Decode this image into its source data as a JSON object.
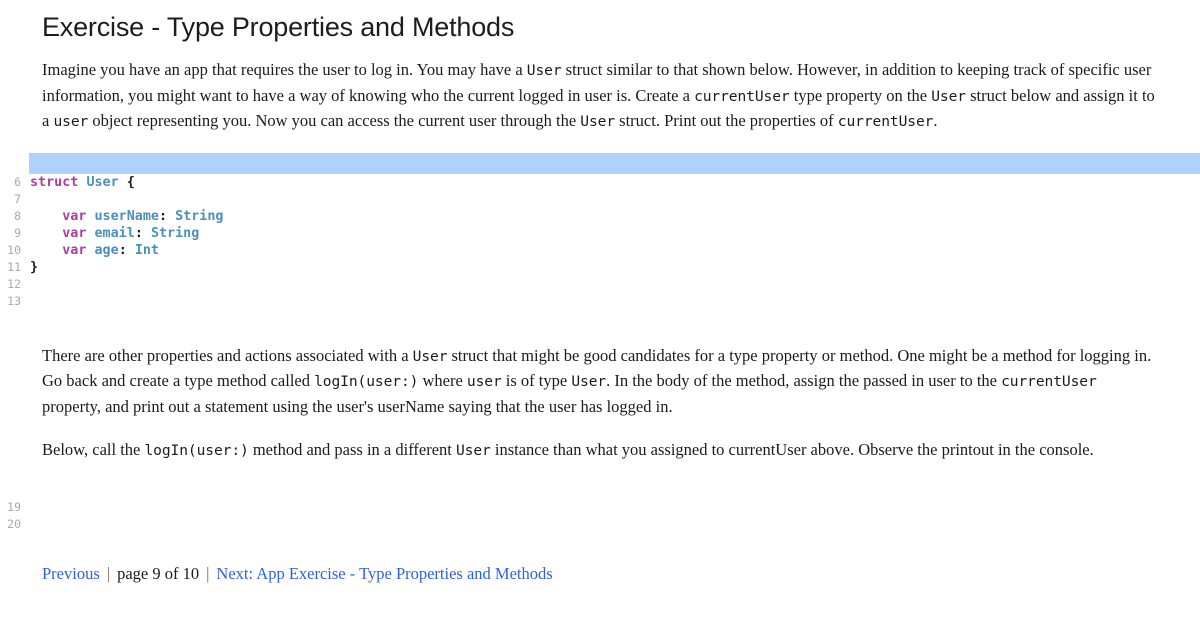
{
  "page": {
    "title": "Exercise - Type Properties and Methods"
  },
  "intro_paragraph": {
    "segments": [
      {
        "type": "text",
        "value": "Imagine you have an app that requires the user to log in. You may have a "
      },
      {
        "type": "code",
        "value": "User"
      },
      {
        "type": "text",
        "value": " struct similar to that shown below. However, in addition to keeping track of specific user information, you might want to have a way of knowing who the current logged in user is. Create a "
      },
      {
        "type": "code",
        "value": "currentUser"
      },
      {
        "type": "text",
        "value": " type property on the "
      },
      {
        "type": "code",
        "value": "User"
      },
      {
        "type": "text",
        "value": " struct below and assign it to a "
      },
      {
        "type": "code",
        "value": "user"
      },
      {
        "type": "text",
        "value": " object representing you. Now you can access the current user through the "
      },
      {
        "type": "code",
        "value": "User"
      },
      {
        "type": "text",
        "value": " struct. Print out the properties of "
      },
      {
        "type": "code",
        "value": "currentUser"
      },
      {
        "type": "text",
        "value": "."
      }
    ]
  },
  "editor": {
    "highlight_color": "#aed2fc",
    "first_visible_line": 6,
    "lines": [
      {
        "number": "6",
        "tokens": [
          {
            "cls": "kw",
            "text": "struct"
          },
          {
            "cls": "pln",
            "text": " "
          },
          {
            "cls": "typ",
            "text": "User"
          },
          {
            "cls": "pln",
            "text": " {"
          }
        ]
      },
      {
        "number": "7",
        "tokens": []
      },
      {
        "number": "8",
        "tokens": [
          {
            "cls": "pln",
            "text": "    "
          },
          {
            "cls": "kw",
            "text": "var"
          },
          {
            "cls": "pln",
            "text": " "
          },
          {
            "cls": "typ",
            "text": "userName"
          },
          {
            "cls": "pln",
            "text": ": "
          },
          {
            "cls": "typ",
            "text": "String"
          }
        ]
      },
      {
        "number": "9",
        "tokens": [
          {
            "cls": "pln",
            "text": "    "
          },
          {
            "cls": "kw",
            "text": "var"
          },
          {
            "cls": "pln",
            "text": " "
          },
          {
            "cls": "typ",
            "text": "email"
          },
          {
            "cls": "pln",
            "text": ": "
          },
          {
            "cls": "typ",
            "text": "String"
          }
        ]
      },
      {
        "number": "10",
        "tokens": [
          {
            "cls": "pln",
            "text": "    "
          },
          {
            "cls": "kw",
            "text": "var"
          },
          {
            "cls": "pln",
            "text": " "
          },
          {
            "cls": "typ",
            "text": "age"
          },
          {
            "cls": "pln",
            "text": ": "
          },
          {
            "cls": "typ",
            "text": "Int"
          }
        ]
      },
      {
        "number": "11",
        "tokens": [
          {
            "cls": "pln",
            "text": "}"
          }
        ]
      },
      {
        "number": "12",
        "tokens": []
      },
      {
        "number": "13",
        "tokens": []
      }
    ],
    "tail_lines": [
      {
        "number": "19",
        "tokens": []
      },
      {
        "number": "20",
        "tokens": []
      }
    ]
  },
  "middle_paragraph": {
    "segments": [
      {
        "type": "text",
        "value": "There are other properties and actions associated with a "
      },
      {
        "type": "code",
        "value": "User"
      },
      {
        "type": "text",
        "value": " struct that might be good candidates for a type property or method. One might be a method for logging in. Go back and create a type method called "
      },
      {
        "type": "code",
        "value": "logIn(user:)"
      },
      {
        "type": "text",
        "value": " where "
      },
      {
        "type": "code",
        "value": "user"
      },
      {
        "type": "text",
        "value": " is of type "
      },
      {
        "type": "code",
        "value": "User"
      },
      {
        "type": "text",
        "value": ". In the body of the method, assign the passed in user to the "
      },
      {
        "type": "code",
        "value": "currentUser"
      },
      {
        "type": "text",
        "value": " property, and print out a statement using the user's userName saying that the user has logged in."
      }
    ]
  },
  "below_paragraph": {
    "segments": [
      {
        "type": "text",
        "value": "Below, call the "
      },
      {
        "type": "code",
        "value": "logIn(user:)"
      },
      {
        "type": "text",
        "value": " method and pass in a different "
      },
      {
        "type": "code",
        "value": "User"
      },
      {
        "type": "text",
        "value": " instance than what you assigned to currentUser above. Observe the printout in the console."
      }
    ]
  },
  "pager": {
    "previous_label": "Previous",
    "separator": "|",
    "page_indicator": "page 9 of 10",
    "next_label": "Next: App Exercise - Type Properties and Methods",
    "link_color": "#2f5fe8"
  }
}
